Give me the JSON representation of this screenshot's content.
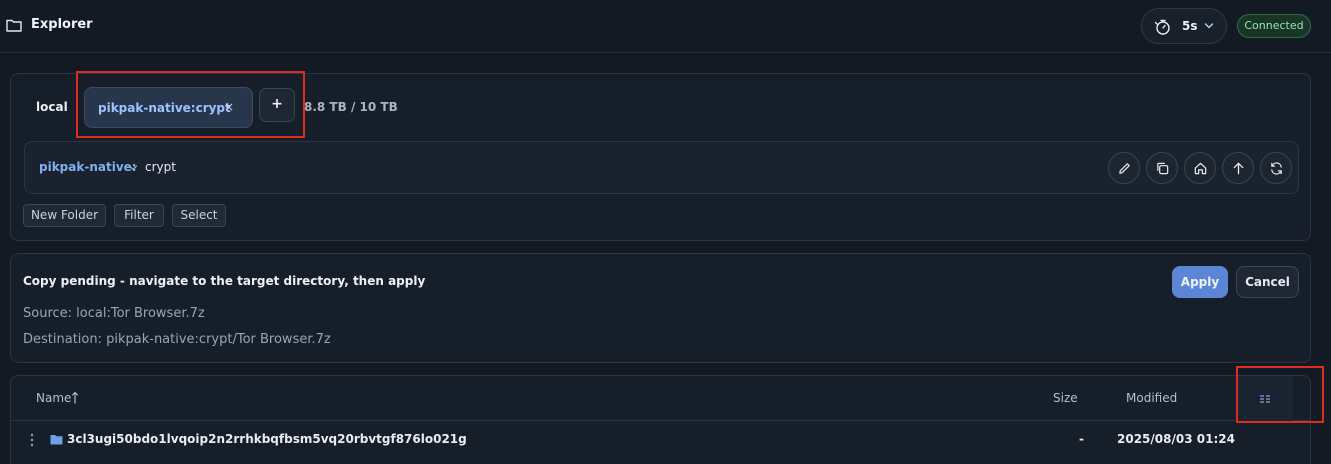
{
  "header": {
    "title": "Explorer",
    "refresh_interval": "5s",
    "status": "Connected"
  },
  "remotes": {
    "local_label": "local",
    "active_tab": "pikpak-native:crypt",
    "close_symbol": "×",
    "add_symbol": "+",
    "storage": "8.8 TB / 10 TB"
  },
  "path": {
    "remote": "pikpak-native:",
    "segment": "crypt"
  },
  "toolbar": {
    "new_folder": "New Folder",
    "filter": "Filter",
    "select": "Select"
  },
  "pending": {
    "title": "Copy pending - navigate to the target directory, then apply",
    "source": "Source: local:Tor Browser.7z",
    "destination": "Destination: pikpak-native:crypt/Tor Browser.7z",
    "apply": "Apply",
    "cancel": "Cancel"
  },
  "table": {
    "columns": [
      "Name",
      "Size",
      "Modified"
    ],
    "rows": [
      {
        "name": "3cl3ugi50bdo1lvqoip2n2rrhkbqfbsm5vq20rbvtgf876lo021g",
        "size": "-",
        "modified": "2025/08/03 01:24"
      }
    ]
  },
  "icons": {
    "top": [
      "folder-icon",
      "timer-icon",
      "chevron-down-icon"
    ],
    "path_actions": [
      "pencil-icon",
      "copy-icon",
      "home-icon",
      "arrow-up-icon",
      "refresh-icon"
    ],
    "table": [
      "sort-up-icon",
      "columns-icon",
      "kebab-icon",
      "folder-icon"
    ]
  },
  "colors": {
    "accent": "#5b86d6",
    "link": "#7fb0f0",
    "success": "#9be0b3",
    "background": "#131a24"
  }
}
